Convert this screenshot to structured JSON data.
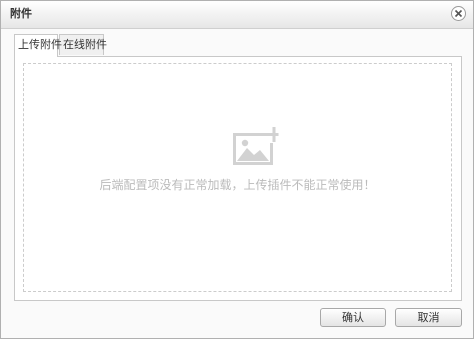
{
  "dialog": {
    "title": "附件"
  },
  "tabs": [
    {
      "label": "上传附件",
      "active": true
    },
    {
      "label": "在线附件",
      "active": false
    }
  ],
  "upload": {
    "icon": "image-add-icon",
    "message": "后端配置项没有正常加载，上传插件不能正常使用！"
  },
  "buttons": {
    "confirm_label": "确认",
    "cancel_label": "取消"
  },
  "colors": {
    "message_text": "#bbbbbb",
    "icon": "#d2d2d2",
    "border": "#c8c8c8"
  }
}
